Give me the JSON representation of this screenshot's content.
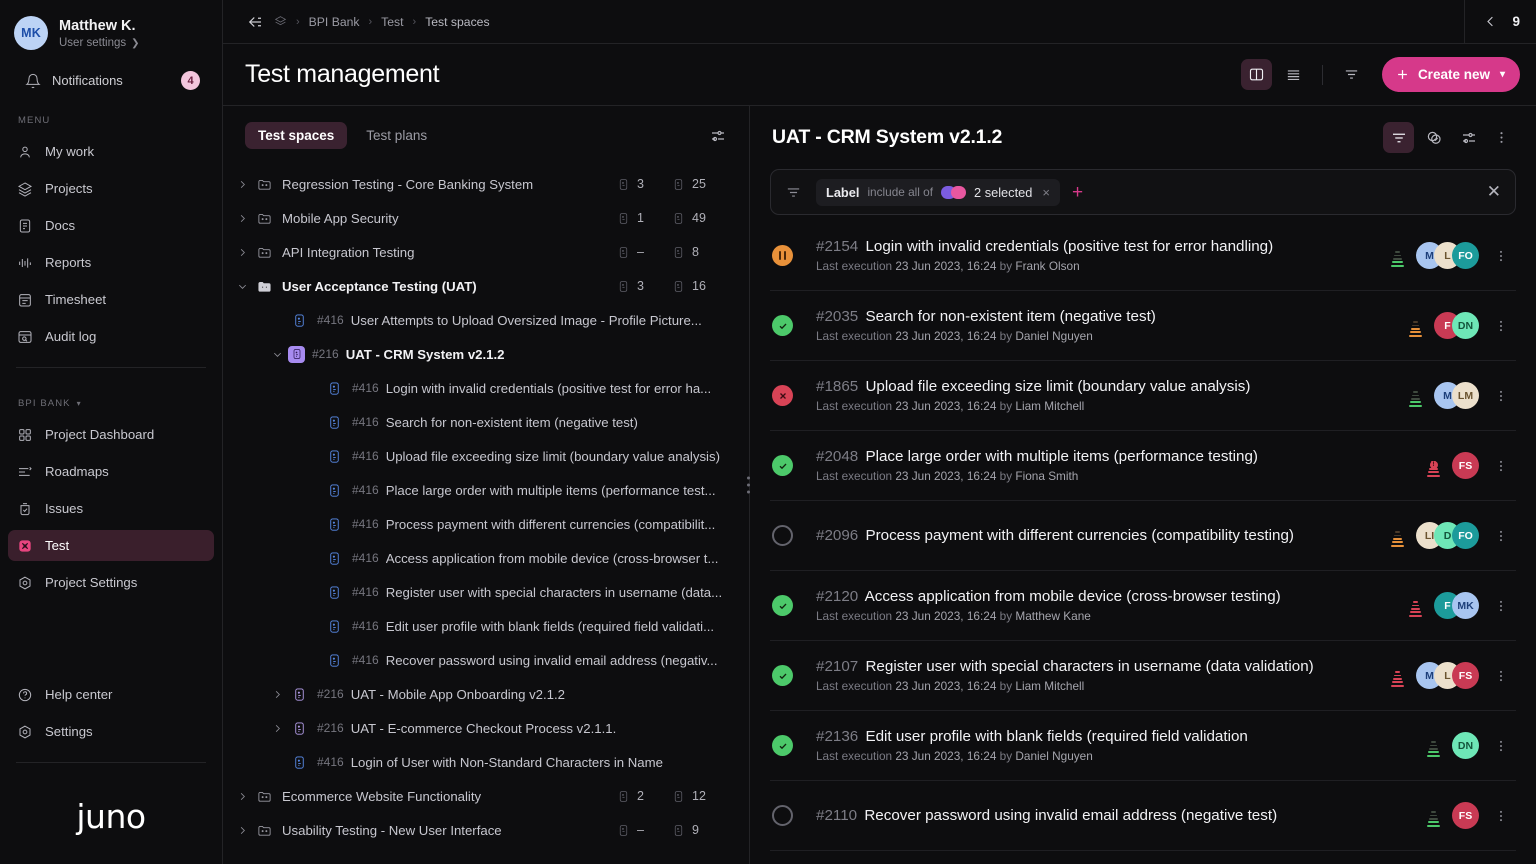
{
  "colors": {
    "accent_pink": "#d6398a",
    "active_bg": "#3a2230",
    "pass_green": "#4cc96a",
    "fail_red": "#d84356",
    "blocked_orange": "#e8913a",
    "notrun_gray": "#63636c",
    "label_pill_1": "#7b5ce0",
    "label_pill_2": "#e857a0",
    "suite_purple": "#a78bf0",
    "case_blue": "#5b8ff0"
  },
  "sidebar": {
    "user": {
      "initials": "MK",
      "name": "Matthew K.",
      "settings_label": "User settings"
    },
    "notifications": {
      "label": "Notifications",
      "count": "4"
    },
    "menu_label": "MENU",
    "menu_items": [
      {
        "label": "My work",
        "icon": "user-icon"
      },
      {
        "label": "Projects",
        "icon": "layers-icon"
      },
      {
        "label": "Docs",
        "icon": "document-icon"
      },
      {
        "label": "Reports",
        "icon": "chart-icon"
      },
      {
        "label": "Timesheet",
        "icon": "calendar-icon"
      },
      {
        "label": "Audit log",
        "icon": "audit-icon"
      }
    ],
    "project_label": "BPI BANK",
    "project_items": [
      {
        "label": "Project Dashboard",
        "icon": "grid-icon",
        "active": false
      },
      {
        "label": "Roadmaps",
        "icon": "roadmap-icon",
        "active": false
      },
      {
        "label": "Issues",
        "icon": "issues-icon",
        "active": false
      },
      {
        "label": "Test",
        "icon": "test-icon",
        "active": true
      },
      {
        "label": "Project Settings",
        "icon": "settings-icon",
        "active": false
      }
    ],
    "bottom_items": [
      {
        "label": "Help center",
        "icon": "help-icon"
      },
      {
        "label": "Settings",
        "icon": "gear-icon"
      }
    ],
    "logo": "juno"
  },
  "topbar": {
    "breadcrumb": [
      "BPI Bank",
      "Test",
      "Test spaces"
    ],
    "separator": "›",
    "counter": "9"
  },
  "pagehead": {
    "title": "Test management",
    "create_label": "Create new"
  },
  "tree_pane": {
    "tabs": [
      {
        "label": "Test spaces",
        "active": true
      },
      {
        "label": "Test plans",
        "active": false
      }
    ],
    "rows": [
      {
        "indent": 0,
        "twisty": "right",
        "icon": "folder",
        "id": "",
        "label": "Regression Testing - Core Banking System",
        "bold": false,
        "c1": "3",
        "c2": "25"
      },
      {
        "indent": 0,
        "twisty": "right",
        "icon": "folder",
        "id": "",
        "label": "Mobile App Security",
        "bold": false,
        "c1": "1",
        "c2": "49"
      },
      {
        "indent": 0,
        "twisty": "right",
        "icon": "folder",
        "id": "",
        "label": "API Integration Testing",
        "bold": false,
        "c1": "–",
        "c2": "8"
      },
      {
        "indent": 0,
        "twisty": "down",
        "icon": "folder-open",
        "id": "",
        "label": "User Acceptance Testing (UAT)",
        "bold": true,
        "c1": "3",
        "c2": "16"
      },
      {
        "indent": 1,
        "twisty": "none",
        "icon": "case",
        "id": "#416",
        "label": "User Attempts to Upload Oversized Image -  Profile Picture...",
        "bold": false,
        "c1": "",
        "c2": ""
      },
      {
        "indent": 1,
        "twisty": "down",
        "icon": "suite-sel",
        "id": "#216",
        "label": "UAT - CRM System v2.1.2",
        "bold": true,
        "c1": "",
        "c2": ""
      },
      {
        "indent": 2,
        "twisty": "none",
        "icon": "case",
        "id": "#416",
        "label": "Login with invalid credentials (positive test for error ha...",
        "bold": false,
        "c1": "",
        "c2": ""
      },
      {
        "indent": 2,
        "twisty": "none",
        "icon": "case",
        "id": "#416",
        "label": "Search for non-existent item (negative test)",
        "bold": false,
        "c1": "",
        "c2": ""
      },
      {
        "indent": 2,
        "twisty": "none",
        "icon": "case",
        "id": "#416",
        "label": "Upload file exceeding size limit (boundary value analysis)",
        "bold": false,
        "c1": "",
        "c2": ""
      },
      {
        "indent": 2,
        "twisty": "none",
        "icon": "case",
        "id": "#416",
        "label": "Place large order with multiple items (performance test...",
        "bold": false,
        "c1": "",
        "c2": ""
      },
      {
        "indent": 2,
        "twisty": "none",
        "icon": "case",
        "id": "#416",
        "label": "Process payment with different currencies (compatibilit...",
        "bold": false,
        "c1": "",
        "c2": ""
      },
      {
        "indent": 2,
        "twisty": "none",
        "icon": "case",
        "id": "#416",
        "label": "Access application from mobile device (cross-browser t...",
        "bold": false,
        "c1": "",
        "c2": ""
      },
      {
        "indent": 2,
        "twisty": "none",
        "icon": "case",
        "id": "#416",
        "label": "Register user with special characters in username (data...",
        "bold": false,
        "c1": "",
        "c2": ""
      },
      {
        "indent": 2,
        "twisty": "none",
        "icon": "case",
        "id": "#416",
        "label": "Edit user profile with blank fields (required field validati...",
        "bold": false,
        "c1": "",
        "c2": ""
      },
      {
        "indent": 2,
        "twisty": "none",
        "icon": "case",
        "id": "#416",
        "label": "Recover password using invalid email address (negativ...",
        "bold": false,
        "c1": "",
        "c2": ""
      },
      {
        "indent": 1,
        "twisty": "right",
        "icon": "suite",
        "id": "#216",
        "label": "UAT - Mobile App Onboarding v2.1.2",
        "bold": false,
        "c1": "",
        "c2": ""
      },
      {
        "indent": 1,
        "twisty": "right",
        "icon": "suite",
        "id": "#216",
        "label": "UAT - E-commerce Checkout Process v2.1.1.",
        "bold": false,
        "c1": "",
        "c2": ""
      },
      {
        "indent": 1,
        "twisty": "none",
        "icon": "case",
        "id": "#416",
        "label": "Login of User with Non-Standard Characters in Name",
        "bold": false,
        "c1": "",
        "c2": ""
      },
      {
        "indent": 0,
        "twisty": "right",
        "icon": "folder",
        "id": "",
        "label": "Ecommerce Website Functionality",
        "bold": false,
        "c1": "2",
        "c2": "12"
      },
      {
        "indent": 0,
        "twisty": "right",
        "icon": "folder",
        "id": "",
        "label": "Usability Testing - New User Interface",
        "bold": false,
        "c1": "–",
        "c2": "9"
      }
    ]
  },
  "detail_pane": {
    "title": "UAT - CRM System v2.1.2",
    "filter": {
      "chip_key": "Label",
      "chip_op": "include all of",
      "chip_value": "2 selected",
      "chip_remove": "×",
      "add": "+",
      "close": "✕"
    },
    "cases": [
      {
        "status": "blocked",
        "id": "#2154",
        "title": "Login with invalid credentials (positive test for error handling)",
        "sub_prefix": "Last execution",
        "sub_date": "23 Jun 2023, 16:24",
        "sub_by": "by",
        "sub_user": "Frank Olson",
        "priority": "low",
        "avatars": [
          {
            "initials": "M",
            "bg": "#a8c5f0",
            "fg": "#1d3f7a"
          },
          {
            "initials": "L",
            "bg": "#ece0cc",
            "fg": "#6b5430"
          },
          {
            "initials": "FO",
            "bg": "#1c9b9b",
            "fg": "#ffffff"
          }
        ]
      },
      {
        "status": "pass",
        "id": "#2035",
        "title": "Search for non-existent item (negative test)",
        "sub_prefix": "Last execution",
        "sub_date": "23 Jun 2023, 16:24",
        "sub_by": "by",
        "sub_user": "Daniel Nguyen",
        "priority": "med",
        "avatars": [
          {
            "initials": "F",
            "bg": "#c93a54",
            "fg": "#ffffff"
          },
          {
            "initials": "DN",
            "bg": "#6ee7b7",
            "fg": "#14553c"
          }
        ]
      },
      {
        "status": "fail",
        "id": "#1865",
        "title": "Upload file exceeding size limit (boundary value analysis)",
        "sub_prefix": "Last execution",
        "sub_date": "23 Jun 2023, 16:24",
        "sub_by": "by",
        "sub_user": "Liam Mitchell",
        "priority": "low",
        "avatars": [
          {
            "initials": "M",
            "bg": "#a8c5f0",
            "fg": "#1d3f7a"
          },
          {
            "initials": "LM",
            "bg": "#ece0cc",
            "fg": "#6b5430"
          }
        ]
      },
      {
        "status": "pass",
        "id": "#2048",
        "title": "Place large order with multiple items (performance testing)",
        "sub_prefix": "Last execution",
        "sub_date": "23 Jun 2023, 16:24",
        "sub_by": "by",
        "sub_user": "Fiona Smith",
        "priority": "crit",
        "avatars": [
          {
            "initials": "FS",
            "bg": "#c93a54",
            "fg": "#ffffff"
          }
        ]
      },
      {
        "status": "notrun",
        "id": "#2096",
        "title": "Process payment with different currencies (compatibility testing)",
        "sub_prefix": "",
        "sub_date": "",
        "sub_by": "",
        "sub_user": "",
        "priority": "med",
        "avatars": [
          {
            "initials": "LI",
            "bg": "#ece0cc",
            "fg": "#6b5430"
          },
          {
            "initials": "D",
            "bg": "#6ee7b7",
            "fg": "#14553c"
          },
          {
            "initials": "FO",
            "bg": "#1c9b9b",
            "fg": "#ffffff"
          }
        ]
      },
      {
        "status": "pass",
        "id": "#2120",
        "title": "Access application from mobile device (cross-browser testing)",
        "sub_prefix": "Last execution",
        "sub_date": "23 Jun 2023, 16:24",
        "sub_by": "by",
        "sub_user": "Matthew Kane",
        "priority": "high",
        "avatars": [
          {
            "initials": "F",
            "bg": "#1c9b9b",
            "fg": "#ffffff"
          },
          {
            "initials": "MK",
            "bg": "#a8c5f0",
            "fg": "#1d3f7a"
          }
        ]
      },
      {
        "status": "pass",
        "id": "#2107",
        "title": "Register user with special characters in username (data validation)",
        "sub_prefix": "Last execution",
        "sub_date": "23 Jun 2023, 16:24",
        "sub_by": "by",
        "sub_user": "Liam Mitchell",
        "priority": "high",
        "avatars": [
          {
            "initials": "M",
            "bg": "#a8c5f0",
            "fg": "#1d3f7a"
          },
          {
            "initials": "L",
            "bg": "#ece0cc",
            "fg": "#6b5430"
          },
          {
            "initials": "FS",
            "bg": "#c93a54",
            "fg": "#ffffff"
          }
        ]
      },
      {
        "status": "pass",
        "id": "#2136",
        "title": "Edit user profile with blank fields (required field validation",
        "sub_prefix": "Last execution",
        "sub_date": "23 Jun 2023, 16:24",
        "sub_by": "by",
        "sub_user": "Daniel Nguyen",
        "priority": "low",
        "avatars": [
          {
            "initials": "DN",
            "bg": "#6ee7b7",
            "fg": "#14553c"
          }
        ]
      },
      {
        "status": "notrun",
        "id": "#2110",
        "title": "Recover password using invalid email address (negative test)",
        "sub_prefix": "",
        "sub_date": "",
        "sub_by": "",
        "sub_user": "",
        "priority": "low",
        "avatars": [
          {
            "initials": "FS",
            "bg": "#c93a54",
            "fg": "#ffffff"
          }
        ]
      }
    ]
  }
}
